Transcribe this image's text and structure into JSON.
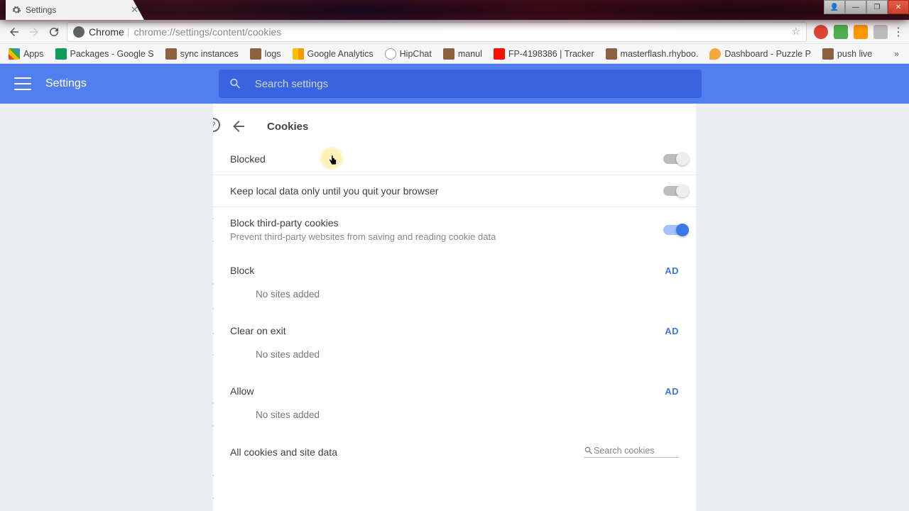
{
  "window": {
    "tab_title": "Settings",
    "win_buttons": [
      "👤",
      "—",
      "❐",
      "✕"
    ]
  },
  "toolbar": {
    "url_scheme": "Chrome",
    "url_path": "chrome://settings/content/cookies"
  },
  "bookmarks": {
    "items": [
      {
        "label": "Apps",
        "icon": "apps"
      },
      {
        "label": "Packages - Google S",
        "icon": "sheets"
      },
      {
        "label": "sync instances",
        "icon": "puzzle"
      },
      {
        "label": "logs",
        "icon": "puzzle"
      },
      {
        "label": "Google Analytics",
        "icon": "ga"
      },
      {
        "label": "HipChat",
        "icon": "hipchat"
      },
      {
        "label": "manul",
        "icon": "puzzle"
      },
      {
        "label": "FP-4198386 | Tracker",
        "icon": "adobe"
      },
      {
        "label": "masterflash.rhyboo.",
        "icon": "puzzle"
      },
      {
        "label": "Dashboard - Puzzle P",
        "icon": "cloud"
      },
      {
        "label": "push live",
        "icon": "puzzle"
      }
    ],
    "overflow": "»"
  },
  "header": {
    "title": "Settings",
    "search_placeholder": "Search settings"
  },
  "page": {
    "title": "Cookies",
    "rows": {
      "blocked": {
        "label": "Blocked"
      },
      "keep_local": {
        "label": "Keep local data only until you quit your browser"
      },
      "third_party": {
        "label": "Block third-party cookies",
        "sub": "Prevent third-party websites from saving and reading cookie data"
      }
    },
    "sections": {
      "block": {
        "title": "Block",
        "add": "AD",
        "empty": "No sites added"
      },
      "clear": {
        "title": "Clear on exit",
        "add": "AD",
        "empty": "No sites added"
      },
      "allow": {
        "title": "Allow",
        "add": "AD",
        "empty": "No sites added"
      }
    },
    "footer": {
      "label": "All cookies and site data",
      "search_placeholder": "Search cookies"
    }
  }
}
